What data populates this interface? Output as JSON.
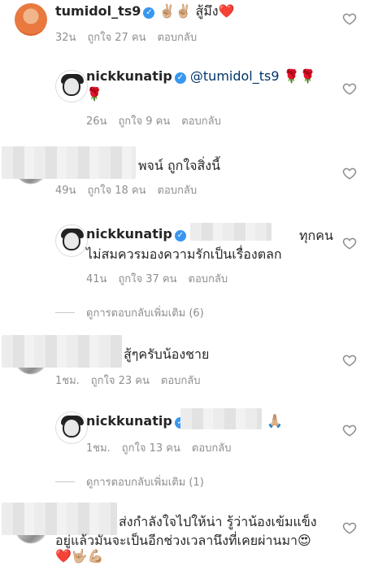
{
  "comments": [
    {
      "user": "tumidol_ts9",
      "text": "✌🏼✌🏼 สู้มึง❤️",
      "time": "32น",
      "likes": "ถูกใจ 27 คน",
      "reply": "ตอบกลับ"
    },
    {
      "user": "nickkunatip",
      "mention": "@tumidol_ts9",
      "text_line1_end": "🌹🌹",
      "text_line2": "🌹",
      "time": "26น",
      "likes": "ถูกใจ 9 คน",
      "reply": "ตอบกลับ"
    },
    {
      "text": "พจน์ ถูกใจสิ่งนี้",
      "time": "49น",
      "likes": "ถูกใจ 18 คน",
      "reply": "ตอบกลับ"
    },
    {
      "user": "nickkunatip",
      "mention": "@",
      "text_line1_end": "ทุกคน",
      "text_line2": "ไม่สมควรมองความรักเป็นเรื่องตลก",
      "time": "41น",
      "likes": "ถูกใจ 37 คน",
      "reply": "ตอบกลับ"
    },
    {
      "text": "สู้ๆครับน้องชาย",
      "time": "1ชม.",
      "likes": "ถูกใจ 23 คน",
      "reply": "ตอบกลับ"
    },
    {
      "user": "nickkunatip",
      "text_end": "🙏🏼",
      "time": "1ชม.",
      "likes": "ถูกใจ 13 คน",
      "reply": "ตอบกลับ"
    },
    {
      "text_line1": "ส่งกำลังใจไปให้น่า รู้ว่าน้องเข้มแข็ง",
      "text_line2": "อยู่แล้วมันจะเป็นอีกช่วงเวลานึงที่เคยผ่านมา😍",
      "text_line3": "❤️🤟🏼💪🏼"
    }
  ],
  "view_more": [
    "ดูการตอบกลับเพิ่มเติม (6)",
    "ดูการตอบกลับเพิ่มเติม (1)"
  ],
  "icons": {
    "heart": "heart-outline-icon",
    "verified": "verified-badge-icon"
  },
  "colors": {
    "text": "#262626",
    "meta": "#8e8e8e",
    "verified": "#3897f0",
    "mention": "#003569"
  }
}
